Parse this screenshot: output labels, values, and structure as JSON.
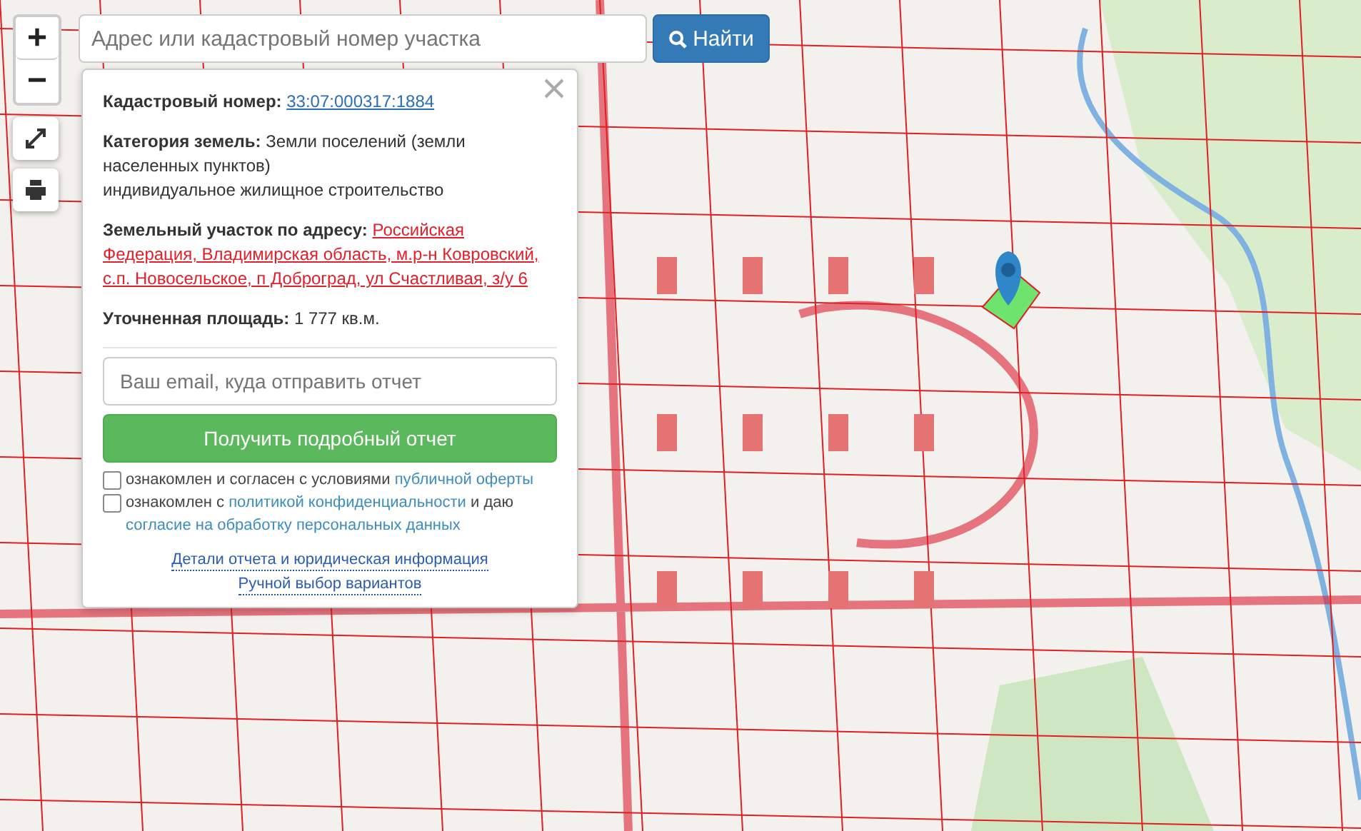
{
  "zoom": {
    "in": "+",
    "out": "−"
  },
  "search": {
    "placeholder": "Адрес или кадастровый номер участка",
    "button": "Найти"
  },
  "info": {
    "fields": [
      {
        "kind": "link",
        "label": "Кадастровый номер:",
        "value": "33:07:000317:1884"
      },
      {
        "kind": "text",
        "label": "Категория земель:",
        "value": "Земли поселений (земли населенных пунктов)",
        "extra": "индивидуальное жилищное строительство"
      },
      {
        "kind": "address",
        "label": "Земельный участок по адресу:",
        "value": "Российская Федерация, Владимирская область, м.р-н Ковровский, с.п. Новосельское, п Доброград, ул Счастливая, з/у 6"
      },
      {
        "kind": "text",
        "label": "Уточненная площадь:",
        "value": "1 777 кв.м."
      }
    ],
    "email_placeholder": "Ваш email, куда отправить отчет",
    "submit": "Получить подробный отчет",
    "consents": [
      {
        "checked": false,
        "parts": [
          {
            "text": "ознакомлен и согласен с условиями",
            "link": false
          },
          {
            "text": "публичной оферты",
            "link": true
          }
        ]
      },
      {
        "checked": false,
        "parts": [
          {
            "text": "ознакомлен с",
            "link": false
          },
          {
            "text": "политикой конфиденциальности",
            "link": true
          },
          {
            "text": "и даю",
            "link": false
          },
          {
            "text": "согласие на обработку персональных данных",
            "link": true
          }
        ]
      }
    ],
    "footer_links": [
      "Детали отчета и юридическая информация",
      "Ручной выбор вариантов"
    ]
  }
}
